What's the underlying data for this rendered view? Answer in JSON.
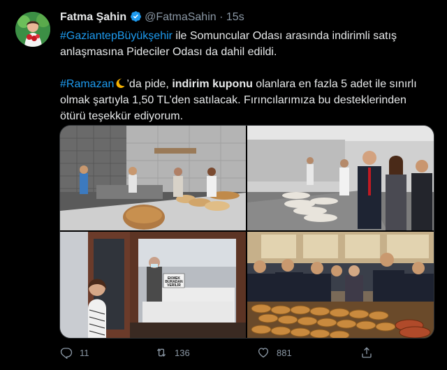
{
  "author": {
    "name": "Fatma Şahin",
    "handle": "@FatmaSahin",
    "separator": "·",
    "time": "15s"
  },
  "tweet": {
    "p1_tag": "#GaziantepBüyükşehir",
    "p1_text": " ile Somuncular Odası arasında indirimli satış anlaşmasına Pideciler Odası da dahil edildi.",
    "p2_tag": "#Ramazan",
    "p2_text_a": "’da pide, ",
    "p2_bold": "indirim kuponu",
    "p2_text_b": " olanlara en fazla 5 adet ile sınırlı olmak şartıyla 1,50 TL’den satılacak. Fırıncılarımıza bu desteklerinden ötürü teşekkür ediyorum."
  },
  "media": {
    "sign_text_1": "EKMEK",
    "sign_text_2": "BURADAN",
    "sign_text_3": "VERİLİR"
  },
  "actions": {
    "reply_count": "11",
    "retweet_count": "136",
    "like_count": "881",
    "share_count": ""
  },
  "colors": {
    "background": "#000000",
    "text": "#e7e9ea",
    "secondary": "#8b98a5",
    "link": "#1d9bf0",
    "verified": "#1d9bf0"
  },
  "icons": [
    "verified-icon",
    "crescent-moon-icon",
    "reply-icon",
    "retweet-icon",
    "like-icon",
    "share-icon"
  ]
}
